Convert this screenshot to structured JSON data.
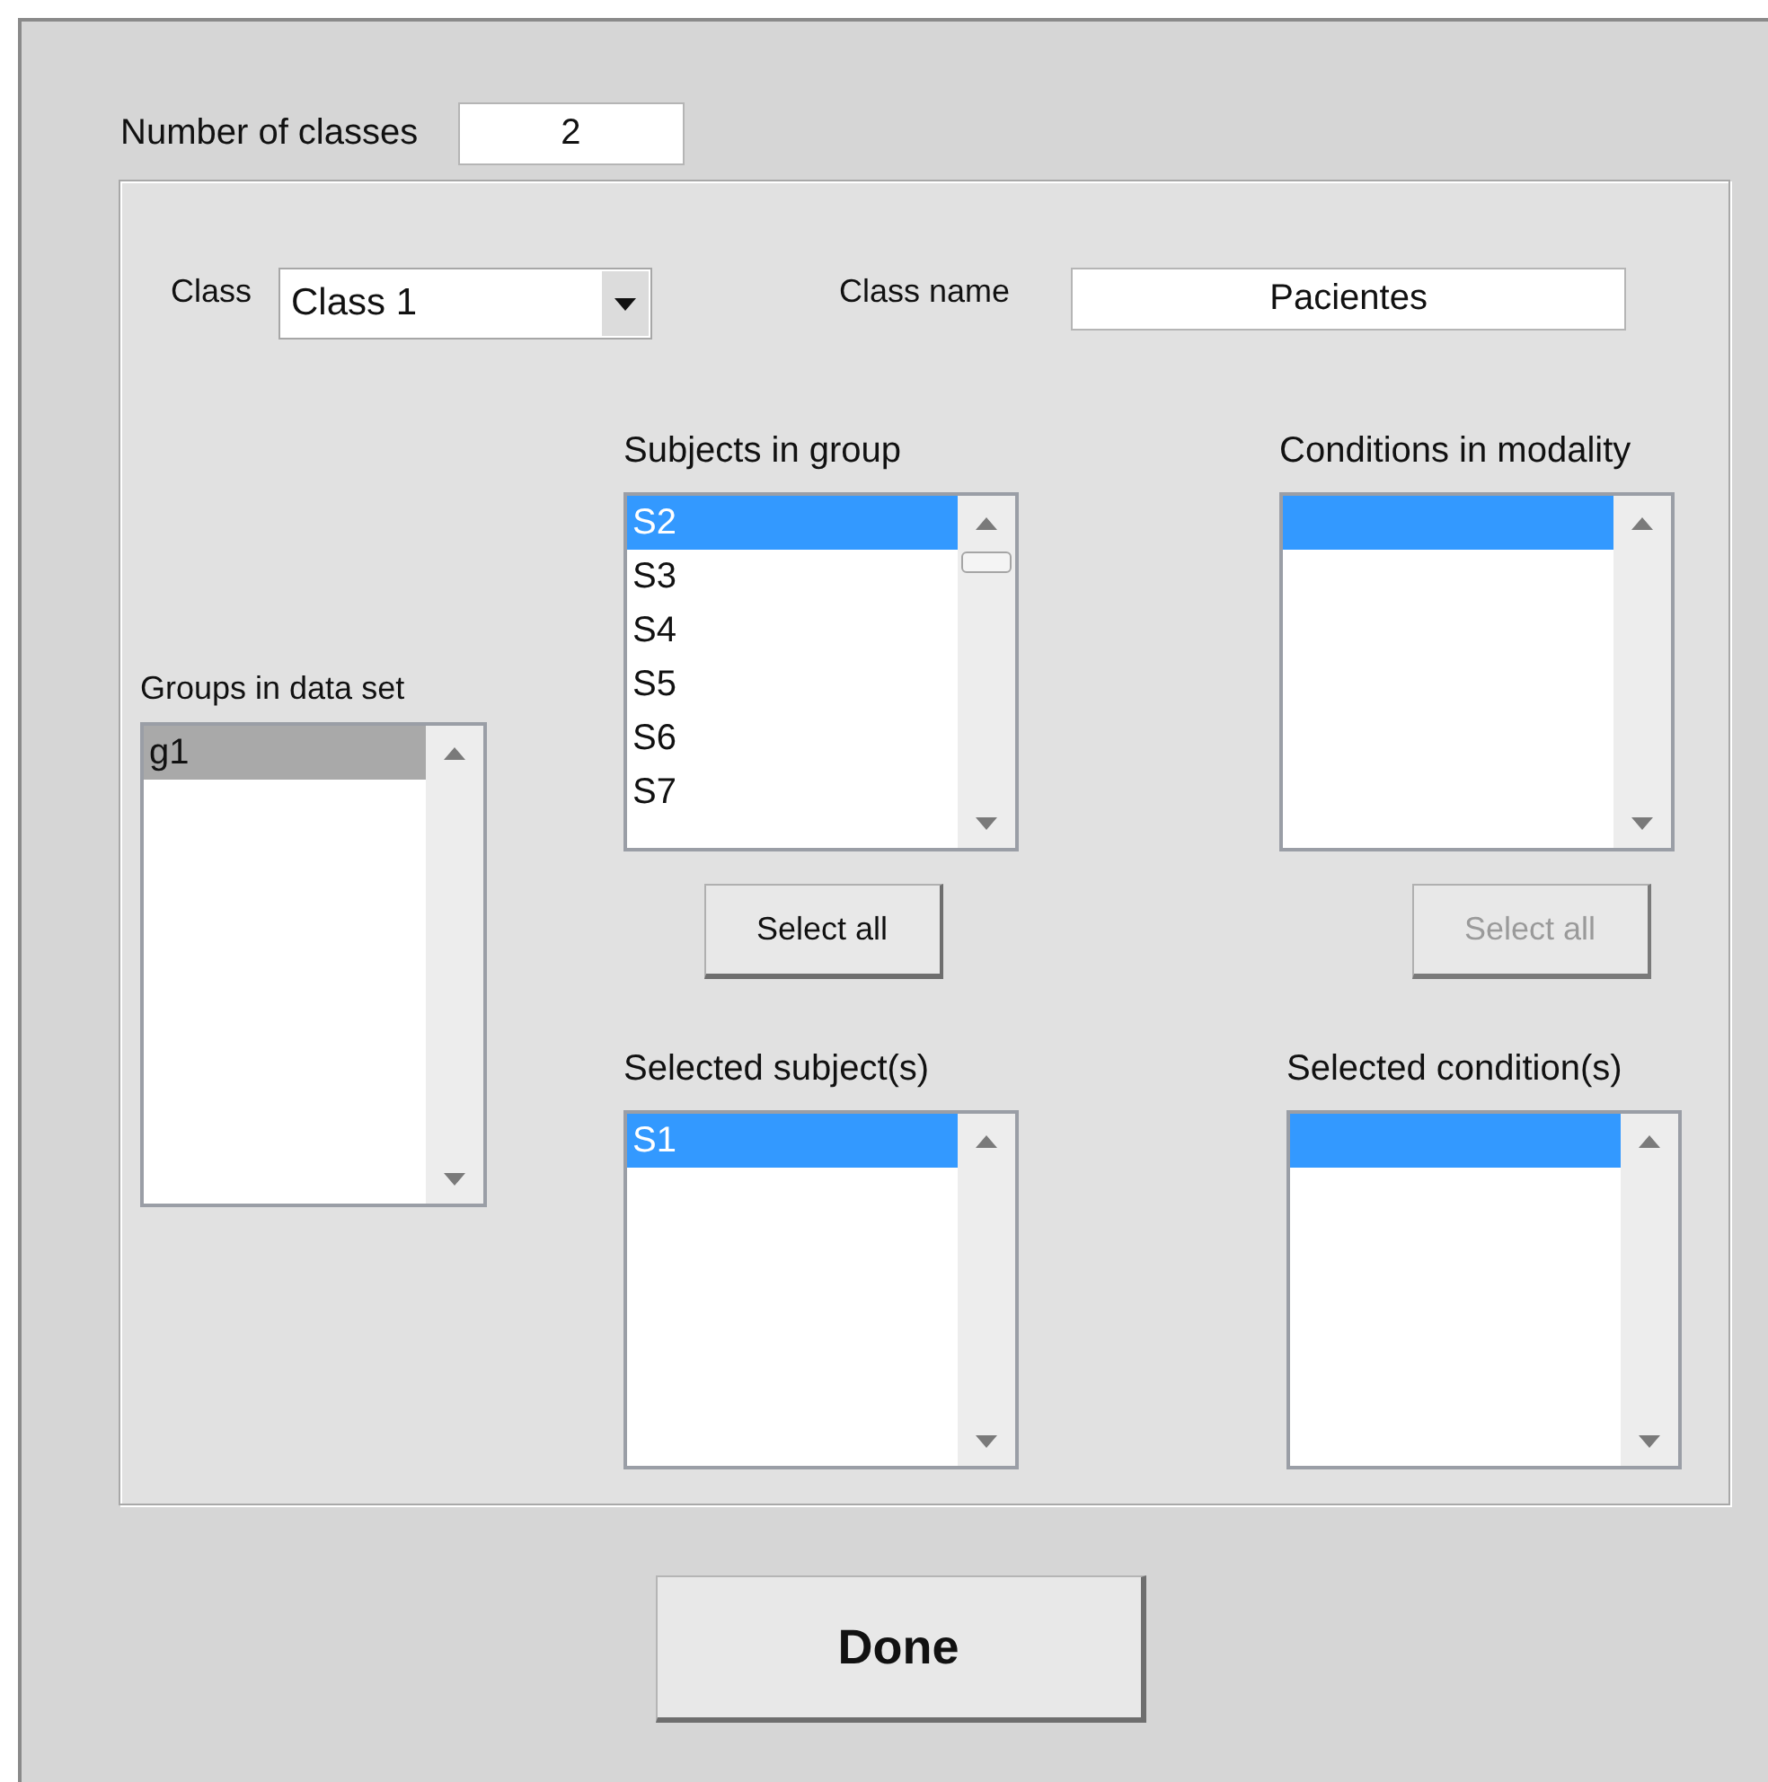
{
  "number_of_classes": {
    "label": "Number of classes",
    "value": "2"
  },
  "class_selector": {
    "label": "Class",
    "value": "Class 1"
  },
  "class_name": {
    "label": "Class name",
    "value": "Pacientes"
  },
  "groups_list": {
    "label": "Groups in data set",
    "active": false,
    "scrollable": false,
    "items": [
      {
        "label": "g1",
        "selected": true
      }
    ]
  },
  "subjects_list": {
    "label": "Subjects in group",
    "active": true,
    "scrollable": true,
    "items": [
      {
        "label": "S2",
        "selected": true
      },
      {
        "label": "S3",
        "selected": false
      },
      {
        "label": "S4",
        "selected": false
      },
      {
        "label": "S5",
        "selected": false
      },
      {
        "label": "S6",
        "selected": false
      },
      {
        "label": "S7",
        "selected": false
      }
    ]
  },
  "subjects_select_all": {
    "label": "Select all",
    "disabled": false
  },
  "selected_subjects_list": {
    "label": "Selected subject(s)",
    "active": true,
    "scrollable": false,
    "items": [
      {
        "label": "S1",
        "selected": true
      }
    ]
  },
  "conditions_list": {
    "label": "Conditions in modality",
    "active": true,
    "scrollable": false,
    "items": [
      {
        "selected": true
      }
    ]
  },
  "conditions_select_all": {
    "label": "Select all",
    "disabled": true
  },
  "selected_conditions_list": {
    "label": "Selected condition(s)",
    "active": true,
    "scrollable": false,
    "items": [
      {
        "selected": true
      }
    ]
  },
  "done_button": {
    "label": "Done"
  }
}
